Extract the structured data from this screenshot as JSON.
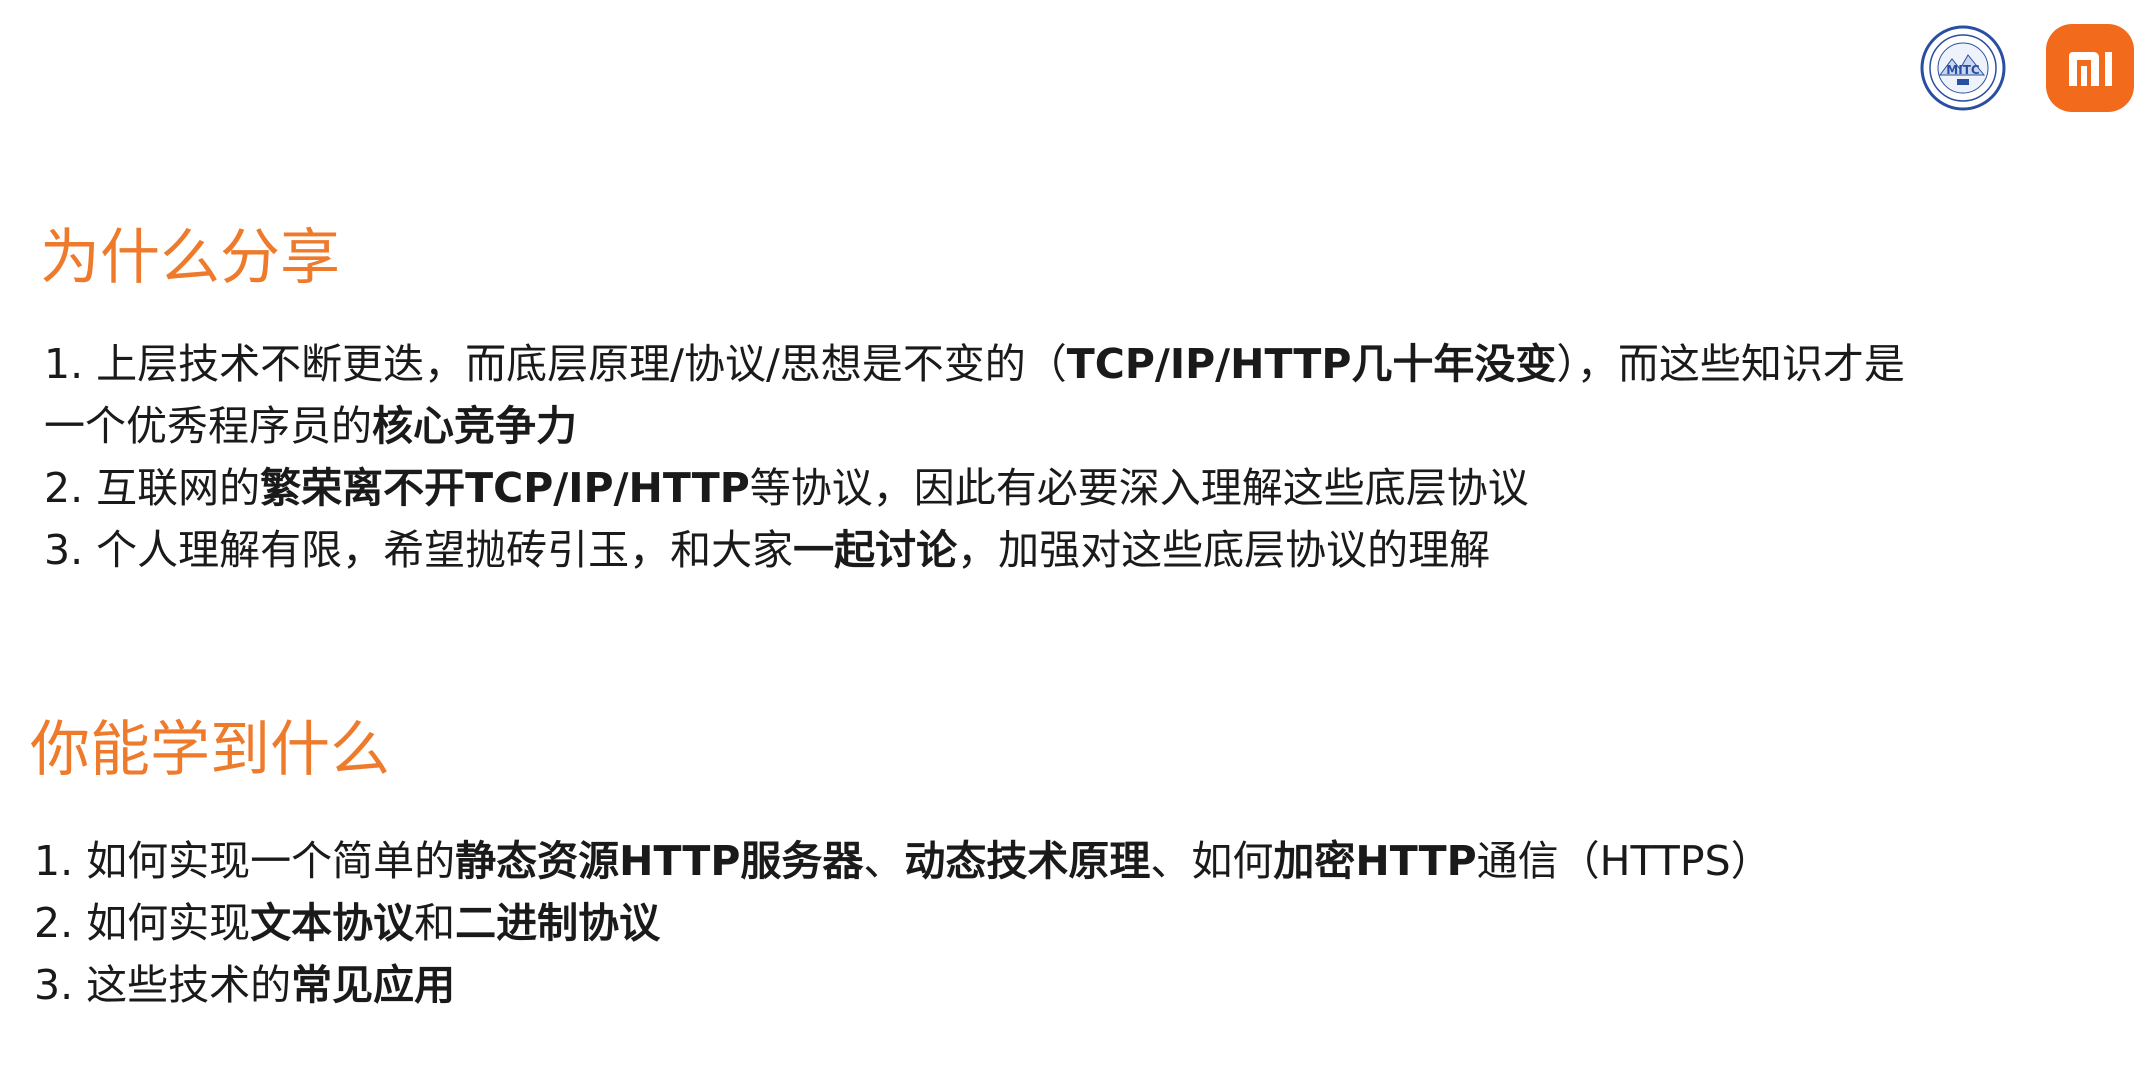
{
  "logos": {
    "mitc_badge_text": "MITC",
    "brand_color": "#f26b1d",
    "accent_color": "#ee7a2c"
  },
  "why_share": {
    "title": "为什么分享",
    "items": [
      {
        "line1": [
          {
            "text": "1. 上层技术不断更迭，而底层原理/协议/思想是不变的（",
            "bold": false
          },
          {
            "text": "TCP/IP/HTTP几十年没变",
            "bold": true
          },
          {
            "text": "），而这些知识才是",
            "bold": false
          }
        ],
        "line2": [
          {
            "text": "一个优秀程序员的",
            "bold": false
          },
          {
            "text": "核心竞争力",
            "bold": true
          }
        ]
      },
      {
        "line1": [
          {
            "text": "2. 互联网的",
            "bold": false
          },
          {
            "text": "繁荣离不开TCP/IP/HTTP",
            "bold": true
          },
          {
            "text": "等协议，因此有必要深入理解这些底层协议",
            "bold": false
          }
        ]
      },
      {
        "line1": [
          {
            "text": "3. 个人理解有限，希望抛砖引玉，和大家",
            "bold": false
          },
          {
            "text": "一起讨论",
            "bold": true
          },
          {
            "text": "，加强对这些底层协议的理解",
            "bold": false
          }
        ]
      }
    ]
  },
  "what_learn": {
    "title": "你能学到什么",
    "items": [
      {
        "line1": [
          {
            "text": "1. 如何实现一个简单的",
            "bold": false
          },
          {
            "text": "静态资源HTTP服务器",
            "bold": true
          },
          {
            "text": "、",
            "bold": false
          },
          {
            "text": "动态技术原理",
            "bold": true
          },
          {
            "text": "、如何",
            "bold": false
          },
          {
            "text": "加密HTTP",
            "bold": true
          },
          {
            "text": "通信（HTTPS）",
            "bold": false
          }
        ]
      },
      {
        "line1": [
          {
            "text": "2. 如何实现",
            "bold": false
          },
          {
            "text": "文本协议",
            "bold": true
          },
          {
            "text": "和",
            "bold": false
          },
          {
            "text": "二进制协议",
            "bold": true
          }
        ]
      },
      {
        "line1": [
          {
            "text": "3. 这些技术的",
            "bold": false
          },
          {
            "text": "常见应用",
            "bold": true
          }
        ]
      }
    ]
  }
}
